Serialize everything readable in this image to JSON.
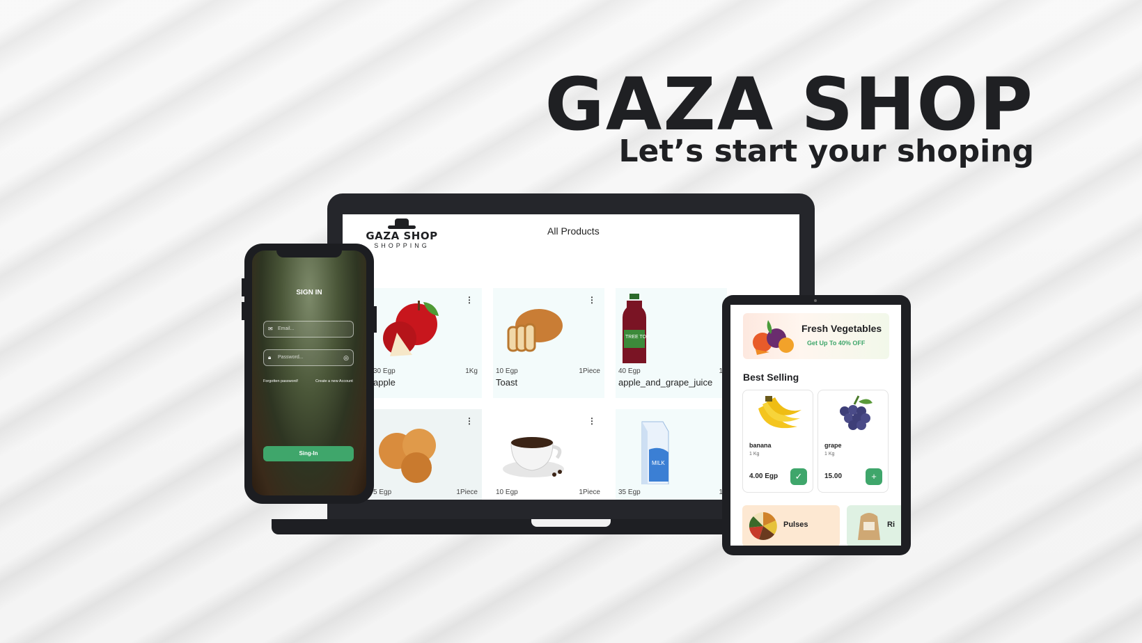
{
  "hero": {
    "title": "GAZA SHOP",
    "subtitle": "Let’s start your shoping"
  },
  "desktop": {
    "logo_name": "GAZA SHOP",
    "logo_tag": "SHOPPING",
    "screen_title": "All Products",
    "products": [
      {
        "price": "30 Egp",
        "unit": "1Kg",
        "name": "apple",
        "icon": "apple-image"
      },
      {
        "price": "10 Egp",
        "unit": "1Piece",
        "name": "Toast",
        "icon": "toast-image"
      },
      {
        "price": "40 Egp",
        "unit": "1",
        "name": "apple_and_grape_juice",
        "icon": "juice-bottle-image"
      },
      {
        "price": "5 Egp",
        "unit": "1Piece",
        "name": "",
        "icon": "buns-image"
      },
      {
        "price": "10 Egp",
        "unit": "1Piece",
        "name": "",
        "icon": "coffee-cup-image"
      },
      {
        "price": "35 Egp",
        "unit": "1",
        "name": "",
        "icon": "milk-carton-image"
      }
    ]
  },
  "phone": {
    "title": "SIGN IN",
    "email_placeholder": "Email...",
    "password_placeholder": "Password...",
    "forgot_link": "Forgotten password!",
    "create_link": "Create a new Account",
    "signin_button": "Sing-In"
  },
  "tablet": {
    "banner_title": "Fresh Vegetables",
    "banner_sub": "Get Up To 40%  OFF",
    "section_title": "Best Selling",
    "products": [
      {
        "name": "banana",
        "qty": "1 Kg",
        "price": "4.00 Egp",
        "action": "✓"
      },
      {
        "name": "grape",
        "qty": "1 Kg",
        "price": "15.00",
        "action": "+"
      }
    ],
    "categories": [
      {
        "label": "Pulses",
        "color": "#fde8d2"
      },
      {
        "label": "Ri",
        "color": "#dff1e3"
      }
    ]
  },
  "colors": {
    "accent": "#3fa66b",
    "dark": "#1f2023"
  }
}
